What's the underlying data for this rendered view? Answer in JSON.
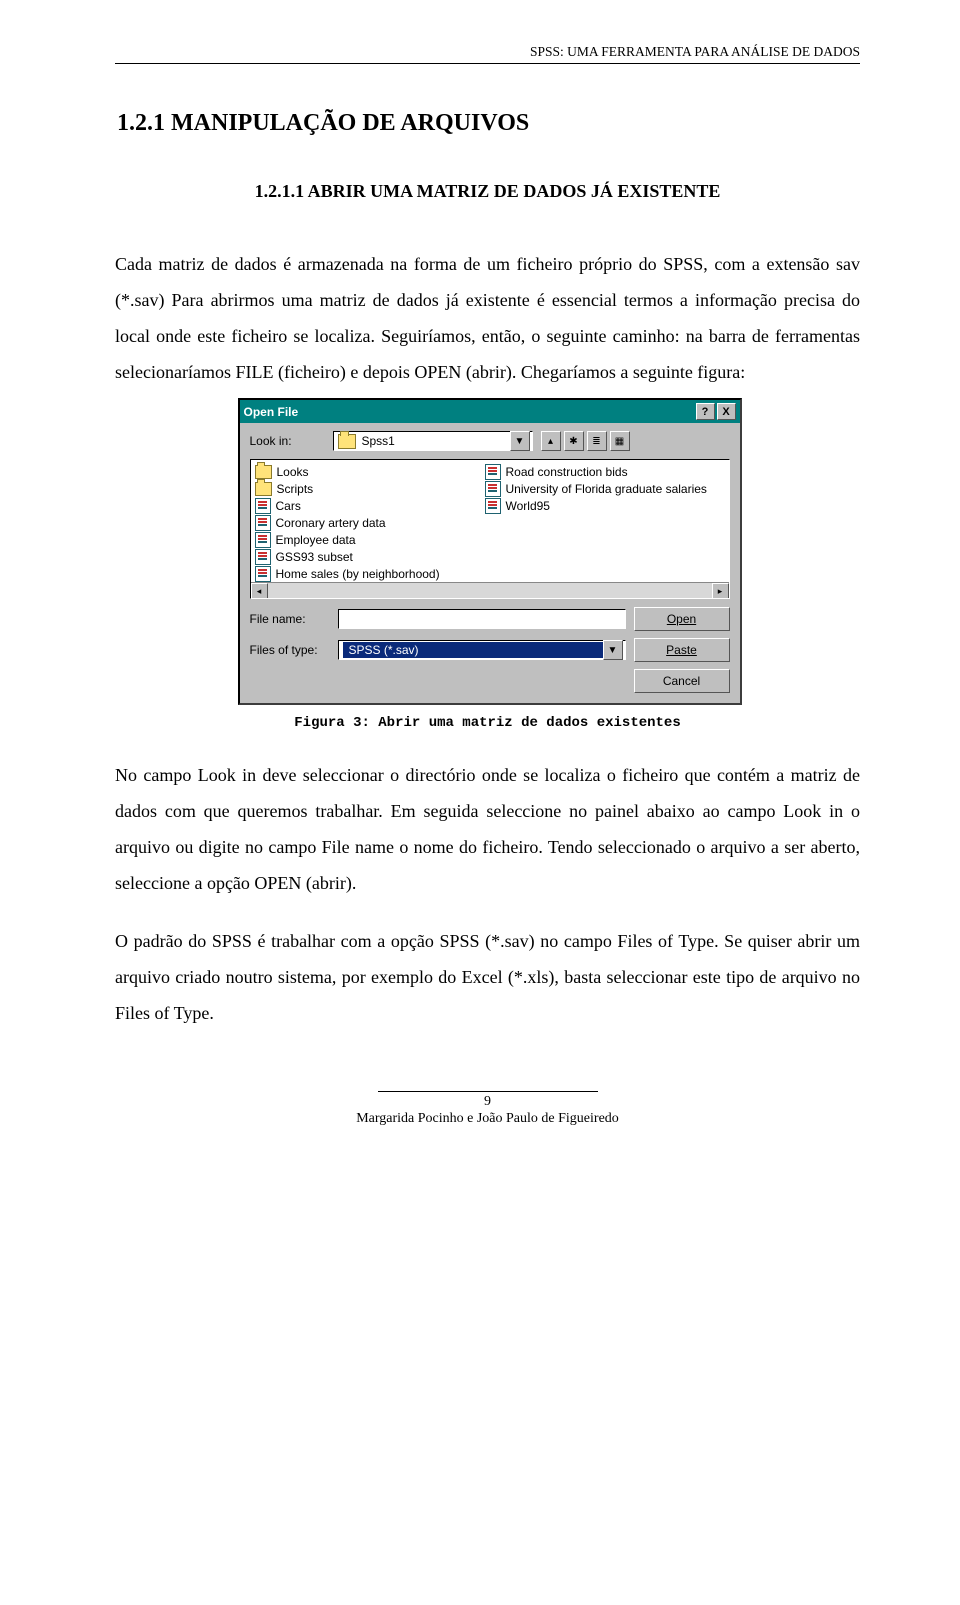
{
  "header": "SPSS: UMA FERRAMENTA PARA ANÁLISE DE DADOS",
  "section_num": "1.2.1",
  "section_title": "MANIPULAÇÃO DE ARQUIVOS",
  "subsection_num": "1.2.1.1",
  "subsection_title": "ABRIR UMA MATRIZ DE DADOS JÁ EXISTENTE",
  "para1": "Cada matriz de dados é armazenada na forma de um ficheiro próprio do SPSS, com a extensão sav (*.sav) Para abrirmos uma matriz de dados já existente é essencial termos a informação precisa do local onde este ficheiro se localiza. Seguiríamos, então, o seguinte caminho: na barra de ferramentas selecionaríamos FILE (ficheiro) e depois OPEN (abrir). Chegaríamos a seguinte figura:",
  "dialog": {
    "title": "Open File",
    "look_in_label": "Look in:",
    "look_in_value": "Spss1",
    "files": [
      {
        "type": "folder",
        "name": "Looks"
      },
      {
        "type": "folder",
        "name": "Scripts"
      },
      {
        "type": "file",
        "name": "Cars"
      },
      {
        "type": "file",
        "name": "Coronary artery data"
      },
      {
        "type": "file",
        "name": "Employee data"
      },
      {
        "type": "file",
        "name": "GSS93 subset"
      },
      {
        "type": "file",
        "name": "Home sales (by neighborhood)"
      },
      {
        "type": "file",
        "name": "Road construction bids"
      },
      {
        "type": "file",
        "name": "University of Florida graduate salaries"
      },
      {
        "type": "file",
        "name": "World95"
      }
    ],
    "file_name_label": "File name:",
    "file_name_value": "",
    "files_type_label": "Files of type:",
    "files_type_value": "SPSS (*.sav)",
    "btn_open": "Open",
    "btn_paste": "Paste",
    "btn_cancel": "Cancel",
    "help_glyph": "?",
    "close_glyph": "X"
  },
  "figure_caption": "Figura 3: Abrir uma matriz de dados existentes",
  "para2": "No campo Look in deve seleccionar o directório onde se localiza o ficheiro que contém a matriz de dados com que queremos trabalhar. Em seguida seleccione no painel abaixo ao campo Look in o arquivo ou digite no campo File name o nome do ficheiro. Tendo seleccionado o arquivo a ser aberto, seleccione a opção OPEN (abrir).",
  "para3": "O padrão do SPSS é trabalhar com a opção SPSS (*.sav) no campo Files of Type. Se quiser abrir um arquivo criado noutro sistema, por exemplo do Excel (*.xls), basta seleccionar este tipo de arquivo no Files of Type.",
  "footer_page": "9",
  "footer_author": "Margarida Pocinho e João Paulo de Figueiredo"
}
